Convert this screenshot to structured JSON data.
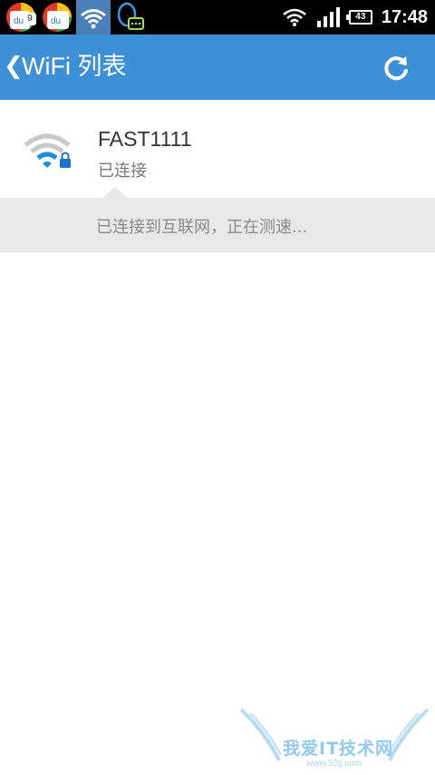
{
  "status_bar": {
    "notifications": [
      {
        "icon": "baidu-app-icon",
        "badge": "9"
      },
      {
        "icon": "baidu-app-icon",
        "badge": ""
      },
      {
        "icon": "wifi-notification-icon",
        "badge": ""
      },
      {
        "icon": "qq-chat-icon",
        "badge": ""
      }
    ],
    "battery": "43",
    "time": "17:48"
  },
  "app_bar": {
    "title": "WiFi 列表",
    "back_icon": "chevron-left-icon",
    "refresh_icon": "refresh-icon"
  },
  "wifi_list": [
    {
      "ssid": "FAST1111",
      "status": "已连接",
      "icon": "wifi-locked-icon"
    }
  ],
  "info_panel": {
    "text": "已连接到互联网，正在测速..."
  },
  "watermark": {
    "main": "我爱IT技术网",
    "sub": "www.52ij.com"
  },
  "colors": {
    "app_bar": "#3d8fd6",
    "status_bar": "#000000",
    "panel": "#e8e8e8",
    "wifi_signal": "#1a8fe0"
  }
}
